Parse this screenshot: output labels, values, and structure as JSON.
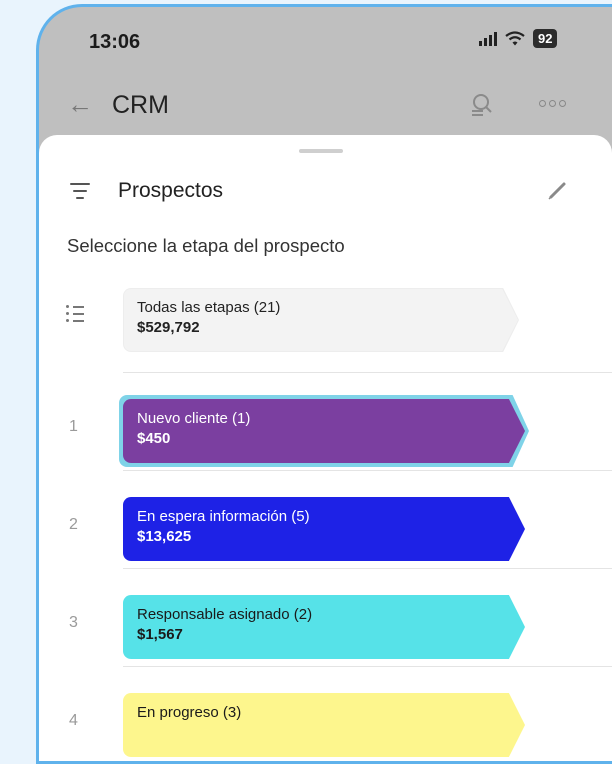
{
  "status_bar": {
    "time": "13:06",
    "battery": "92"
  },
  "app_bar": {
    "back_icon": "arrow-left-icon",
    "title": "CRM"
  },
  "sheet": {
    "title": "Prospectos",
    "instruction": "Seleccione la etapa del prospecto",
    "all_stages": {
      "label": "Todas las etapas (21)",
      "amount": "$529,792",
      "bg": "#f3f3f3",
      "text": "#222222"
    },
    "stages": [
      {
        "number": "1",
        "label": "Nuevo cliente (1)",
        "amount": "$450",
        "bg": "#7b3fa0",
        "text": "#ffffff",
        "selected": true
      },
      {
        "number": "2",
        "label": "En espera información (5)",
        "amount": "$13,625",
        "bg": "#1e22e6",
        "text": "#ffffff"
      },
      {
        "number": "3",
        "label": "Responsable asignado (2)",
        "amount": "$1,567",
        "bg": "#56e2e8",
        "text": "#1a1a1a"
      },
      {
        "number": "4",
        "label": "En progreso (3)",
        "amount": "",
        "bg": "#fdf68d",
        "text": "#1a1a1a"
      }
    ]
  },
  "colors": {
    "frame": "#5fb2ec",
    "selected_outline": "#7fd3e8",
    "page_bg": "#e9f4fd"
  }
}
